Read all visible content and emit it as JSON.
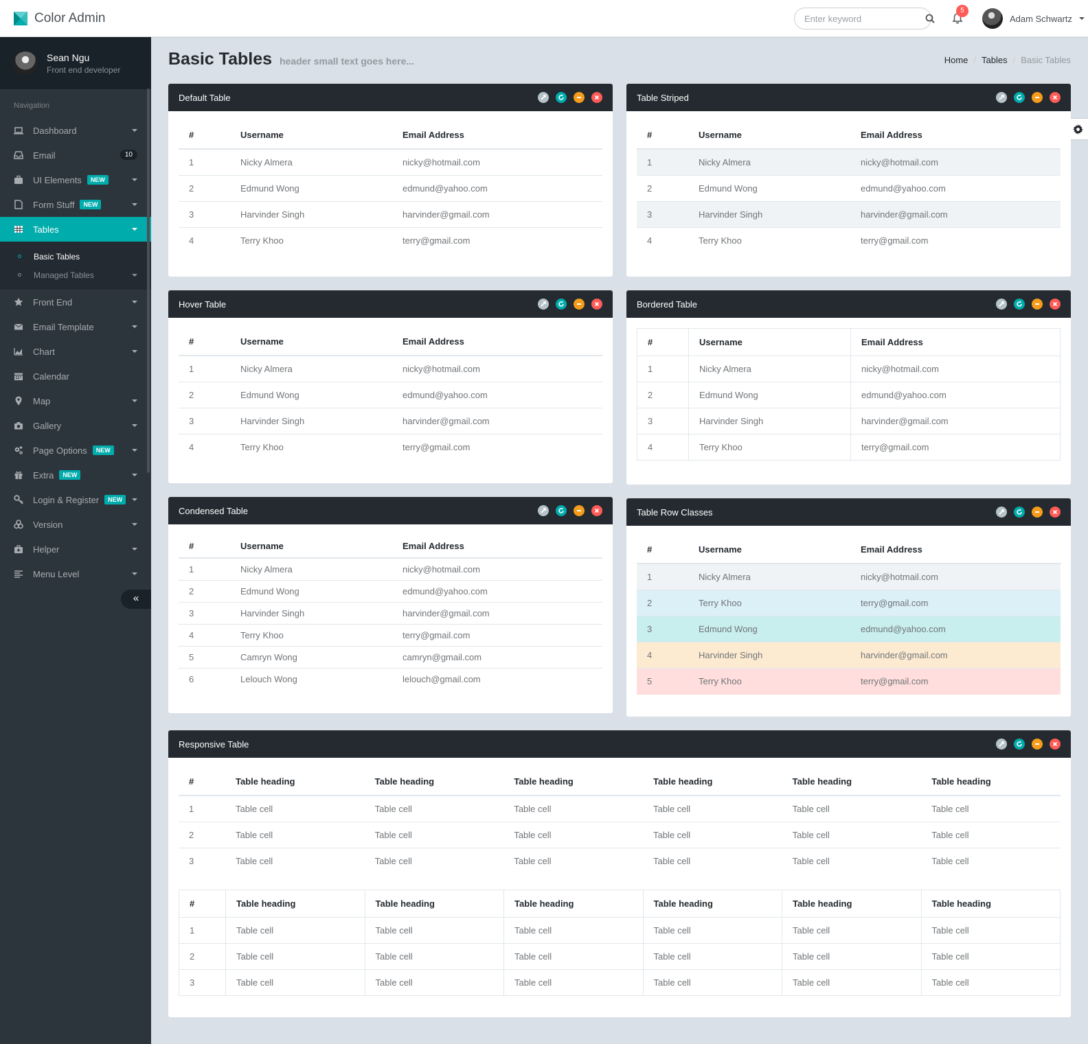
{
  "header": {
    "brand": "Color Admin",
    "search_placeholder": "Enter keyword",
    "notification_count": "5",
    "user_name": "Adam Schwartz"
  },
  "sidebar": {
    "profile": {
      "name": "Sean Ngu",
      "role": "Front end developer"
    },
    "nav_header": "Navigation",
    "items": [
      {
        "label": "Dashboard",
        "icon": "laptop-icon"
      },
      {
        "label": "Email",
        "icon": "inbox-icon",
        "count": "10"
      },
      {
        "label": "UI Elements",
        "icon": "suitcase-icon",
        "badge": "NEW"
      },
      {
        "label": "Form Stuff",
        "icon": "file-icon",
        "badge": "NEW"
      },
      {
        "label": "Tables",
        "icon": "table-icon"
      },
      {
        "label": "Front End",
        "icon": "star-icon"
      },
      {
        "label": "Email Template",
        "icon": "envelope-icon"
      },
      {
        "label": "Chart",
        "icon": "area-chart-icon"
      },
      {
        "label": "Calendar",
        "icon": "calendar-icon"
      },
      {
        "label": "Map",
        "icon": "map-marker-icon"
      },
      {
        "label": "Gallery",
        "icon": "camera-icon"
      },
      {
        "label": "Page Options",
        "icon": "cogs-icon",
        "badge": "NEW"
      },
      {
        "label": "Extra",
        "icon": "gift-icon",
        "badge": "NEW"
      },
      {
        "label": "Login & Register",
        "icon": "key-icon",
        "badge": "NEW"
      },
      {
        "label": "Version",
        "icon": "cubes-icon"
      },
      {
        "label": "Helper",
        "icon": "medkit-icon"
      },
      {
        "label": "Menu Level",
        "icon": "align-left-icon"
      }
    ],
    "tables_sub": [
      "Basic Tables",
      "Managed Tables"
    ],
    "minify_icon": "«"
  },
  "page": {
    "title": "Basic Tables",
    "subtitle": "header small text goes here...",
    "breadcrumb": [
      "Home",
      "Tables",
      "Basic Tables"
    ]
  },
  "tables": {
    "columns": [
      "#",
      "Username",
      "Email Address"
    ],
    "rows4": [
      [
        "1",
        "Nicky Almera",
        "nicky@hotmail.com"
      ],
      [
        "2",
        "Edmund Wong",
        "edmund@yahoo.com"
      ],
      [
        "3",
        "Harvinder Singh",
        "harvinder@gmail.com"
      ],
      [
        "4",
        "Terry Khoo",
        "terry@gmail.com"
      ]
    ],
    "rows6": [
      [
        "1",
        "Nicky Almera",
        "nicky@hotmail.com"
      ],
      [
        "2",
        "Edmund Wong",
        "edmund@yahoo.com"
      ],
      [
        "3",
        "Harvinder Singh",
        "harvinder@gmail.com"
      ],
      [
        "4",
        "Terry Khoo",
        "terry@gmail.com"
      ],
      [
        "5",
        "Camryn Wong",
        "camryn@gmail.com"
      ],
      [
        "6",
        "Lelouch Wong",
        "lelouch@gmail.com"
      ]
    ],
    "row_classes": [
      {
        "cls": "active",
        "cells": [
          "1",
          "Nicky Almera",
          "nicky@hotmail.com"
        ]
      },
      {
        "cls": "info",
        "cells": [
          "2",
          "Terry Khoo",
          "terry@gmail.com"
        ]
      },
      {
        "cls": "success",
        "cells": [
          "3",
          "Edmund Wong",
          "edmund@yahoo.com"
        ]
      },
      {
        "cls": "warning",
        "cells": [
          "4",
          "Harvinder Singh",
          "harvinder@gmail.com"
        ]
      },
      {
        "cls": "danger",
        "cells": [
          "5",
          "Terry Khoo",
          "terry@gmail.com"
        ]
      }
    ],
    "responsive_heading": "Table heading",
    "responsive_cell": "Table cell",
    "responsive_rows": [
      "1",
      "2",
      "3"
    ]
  },
  "panels": {
    "default": "Default Table",
    "striped": "Table Striped",
    "hover": "Hover Table",
    "bordered": "Bordered Table",
    "condensed": "Condensed Table",
    "row_classes": "Table Row Classes",
    "responsive": "Responsive Table"
  },
  "colors": {
    "accent": "#00acac",
    "sidebar_bg": "#2d353c",
    "panel_heading_bg": "#242a30",
    "warning": "#f59c1a",
    "danger": "#ff5b57"
  }
}
